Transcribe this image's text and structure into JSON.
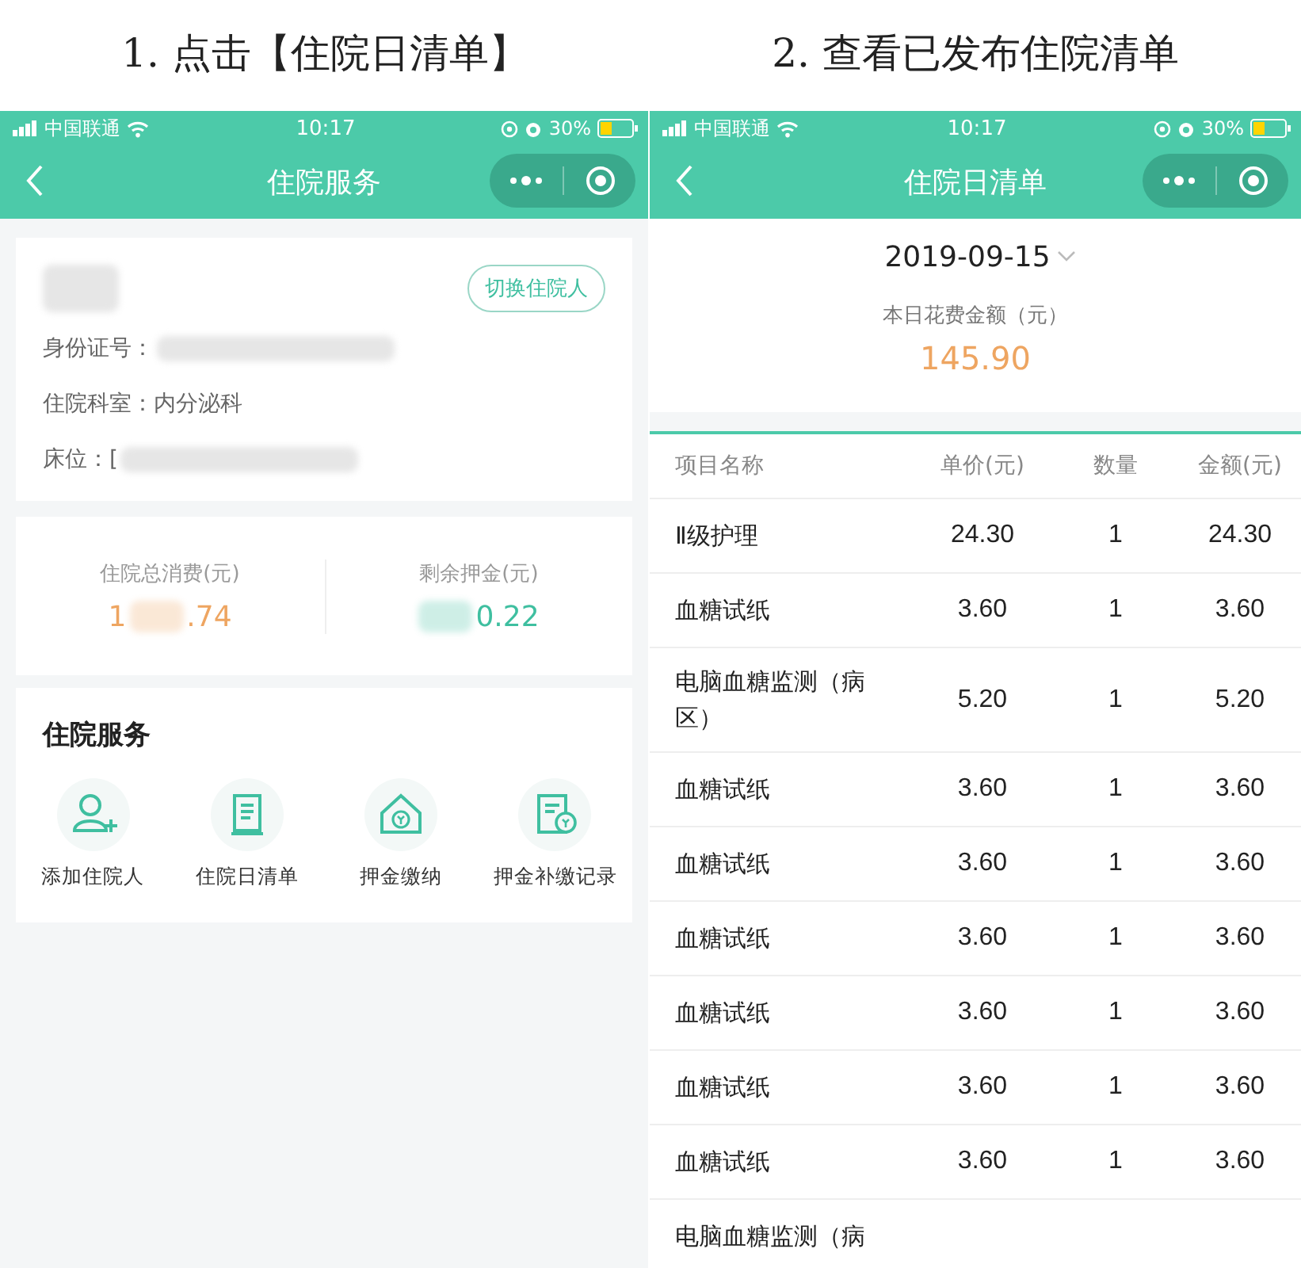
{
  "captions": [
    "1. 点击【住院日清单】",
    "2. 查看已发布住院清单"
  ],
  "left_screen": {
    "status_bar": {
      "carrier": "中国联通",
      "time": "10:17",
      "battery": "30%"
    },
    "title": "住院服务",
    "patient": {
      "name_redacted": true,
      "switch_button": "切换住院人",
      "fields": [
        {
          "label": "身份证号：",
          "redacted": true
        },
        {
          "label": "住院科室：",
          "value": "内分泌科",
          "redacted": false
        },
        {
          "label": "床位：",
          "value": "[",
          "redacted": true
        }
      ]
    },
    "stats": [
      {
        "label": "住院总消费(元)",
        "before": "1",
        "after": ".74",
        "color": "#eea561"
      },
      {
        "label": "剩余押金(元)",
        "after": "0.22",
        "color": "#3fbfa0"
      }
    ],
    "services": {
      "title": "住院服务",
      "items": [
        {
          "label": "添加住院人",
          "kind": "person"
        },
        {
          "label": "住院日清单",
          "kind": "list"
        },
        {
          "label": "押金缴纳",
          "kind": "house"
        },
        {
          "label": "押金补缴记录",
          "kind": "record"
        }
      ]
    }
  },
  "right_screen": {
    "status_bar": {
      "carrier": "中国联通",
      "time": "10:17",
      "battery": "30%"
    },
    "title": "住院日清单",
    "date": "2019-09-15",
    "summary_label": "本日花费金额（元）",
    "summary_amount": "145.90",
    "table": {
      "columns": [
        "项目名称",
        "单价(元)",
        "数量",
        "金额(元)"
      ],
      "rows": [
        [
          "Ⅱ级护理",
          "24.30",
          "1",
          "24.30"
        ],
        [
          "血糖试纸",
          "3.60",
          "1",
          "3.60"
        ],
        [
          "电脑血糖监测（病区）",
          "5.20",
          "1",
          "5.20"
        ],
        [
          "血糖试纸",
          "3.60",
          "1",
          "3.60"
        ],
        [
          "血糖试纸",
          "3.60",
          "1",
          "3.60"
        ],
        [
          "血糖试纸",
          "3.60",
          "1",
          "3.60"
        ],
        [
          "血糖试纸",
          "3.60",
          "1",
          "3.60"
        ],
        [
          "血糖试纸",
          "3.60",
          "1",
          "3.60"
        ],
        [
          "血糖试纸",
          "3.60",
          "1",
          "3.60"
        ],
        [
          "电脑血糖监测（病"
        ]
      ]
    }
  }
}
